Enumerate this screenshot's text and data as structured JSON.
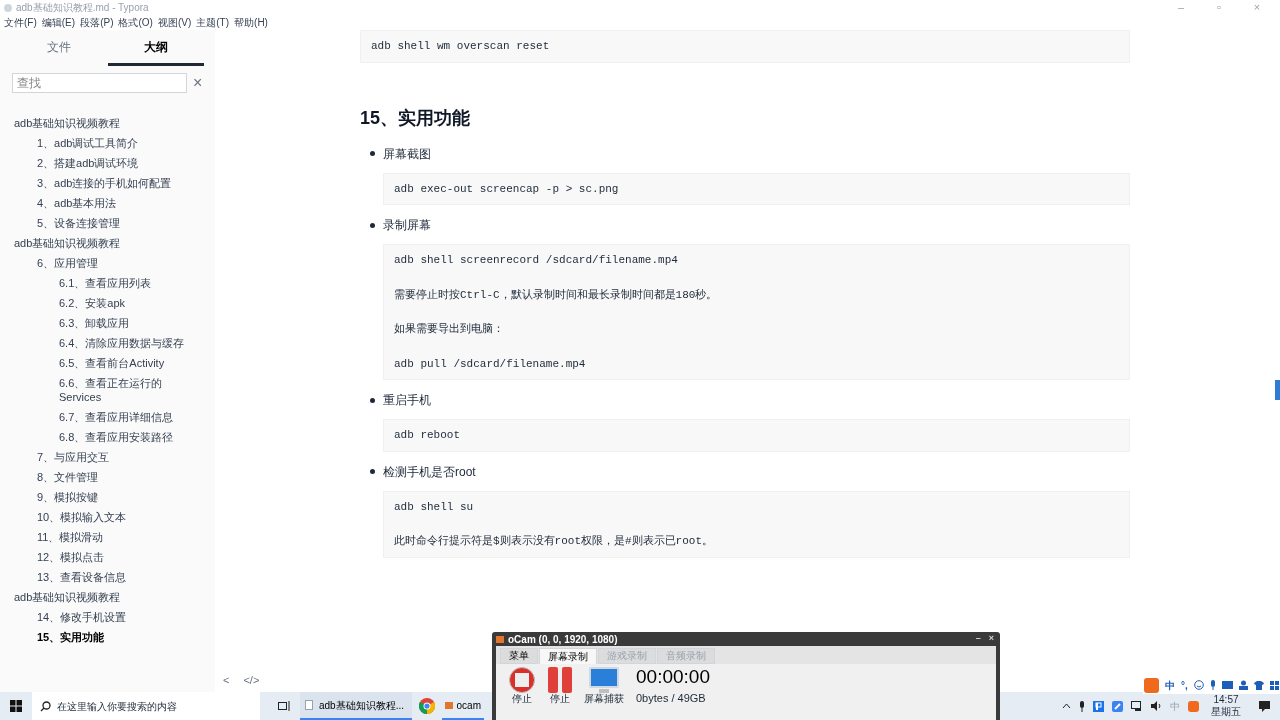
{
  "window": {
    "title": "adb基础知识教程.md - Typora",
    "controls": [
      "–",
      "▫",
      "×"
    ]
  },
  "menu": [
    "文件(F)",
    "编辑(E)",
    "段落(P)",
    "格式(O)",
    "视图(V)",
    "主题(T)",
    "帮助(H)"
  ],
  "sidebar": {
    "tabs": [
      {
        "label": "文件",
        "selected": false
      },
      {
        "label": "大纲",
        "selected": true
      }
    ],
    "search": {
      "placeholder": "查找",
      "clear": "×"
    },
    "outline": [
      {
        "label": "adb基础知识视频教程",
        "selected": false,
        "children": [
          {
            "label": "1、adb调试工具简介",
            "selected": false
          },
          {
            "label": "2、搭建adb调试环境",
            "selected": false
          },
          {
            "label": "3、adb连接的手机如何配置",
            "selected": false
          },
          {
            "label": "4、adb基本用法",
            "selected": false
          },
          {
            "label": "5、设备连接管理",
            "selected": false
          }
        ]
      },
      {
        "label": "adb基础知识视频教程",
        "selected": false,
        "children": [
          {
            "label": "6、应用管理",
            "selected": false,
            "children": [
              {
                "label": "6.1、查看应用列表",
                "selected": false
              },
              {
                "label": "6.2、安装apk",
                "selected": false
              },
              {
                "label": "6.3、卸载应用",
                "selected": false
              },
              {
                "label": "6.4、清除应用数据与缓存",
                "selected": false
              },
              {
                "label": "6.5、查看前台Activity",
                "selected": false
              },
              {
                "label": "6.6、查看正在运行的Services",
                "selected": false
              },
              {
                "label": "6.7、查看应用详细信息",
                "selected": false
              },
              {
                "label": "6.8、查看应用安装路径",
                "selected": false
              }
            ]
          },
          {
            "label": "7、与应用交互",
            "selected": false
          },
          {
            "label": "8、文件管理",
            "selected": false
          },
          {
            "label": "9、模拟按键",
            "selected": false
          },
          {
            "label": "10、模拟输入文本",
            "selected": false
          },
          {
            "label": "11、模拟滑动",
            "selected": false
          },
          {
            "label": "12、模拟点击",
            "selected": false
          },
          {
            "label": "13、查看设备信息",
            "selected": false
          }
        ]
      },
      {
        "label": "adb基础知识视频教程",
        "selected": false,
        "children": [
          {
            "label": "14、修改手机设置",
            "selected": false
          },
          {
            "label": "15、实用功能",
            "selected": true
          }
        ]
      }
    ],
    "footer": [
      "<",
      "</>"
    ]
  },
  "document": {
    "top_code": [
      "adb shell wm overscan reset"
    ],
    "heading": "15、实用功能",
    "items": [
      {
        "label": "屏幕截图",
        "code": [
          "adb exec-out screencap -p > sc.png"
        ]
      },
      {
        "label": "录制屏幕",
        "code": [
          "adb shell screenrecord /sdcard/filename.mp4",
          "需要停止时按Ctrl-C，默认录制时间和最长录制时间都是180秒。",
          "如果需要导出到电脑：",
          "adb pull /sdcard/filename.mp4"
        ]
      },
      {
        "label": "重启手机",
        "code": [
          "adb reboot"
        ]
      },
      {
        "label": "检测手机是否root",
        "code": [
          "adb shell su",
          "此时命令行提示符是$则表示没有root权限，是#则表示已root。"
        ]
      }
    ]
  },
  "ocam": {
    "title": "oCam (0, 0, 1920, 1080)",
    "controls": [
      "–",
      "×"
    ],
    "tabs": [
      {
        "label": "菜单",
        "selected": false,
        "disabled": false
      },
      {
        "label": "屏幕录制",
        "selected": true,
        "disabled": false
      },
      {
        "label": "游戏录制",
        "selected": false,
        "disabled": true
      },
      {
        "label": "音频录制",
        "selected": false,
        "disabled": true
      }
    ],
    "buttons": [
      {
        "kind": "stop",
        "label": "停止"
      },
      {
        "kind": "pause",
        "label": "停止"
      },
      {
        "kind": "capture",
        "label": "屏幕捕获"
      }
    ],
    "timer": "00:00:00",
    "size": "0bytes / 49GB"
  },
  "ime_bar": [
    "中",
    "°,"
  ],
  "taskbar": {
    "search": {
      "placeholder": "在这里输入你要搜索的内容"
    },
    "apps": [
      {
        "kind": "taskview"
      },
      {
        "kind": "typora",
        "label": "adb基础知识教程..."
      },
      {
        "kind": "chrome"
      },
      {
        "kind": "ocam",
        "label": "ocam"
      }
    ],
    "tray": {
      "ime": "中",
      "time": "14:57",
      "day": "星期五"
    }
  }
}
